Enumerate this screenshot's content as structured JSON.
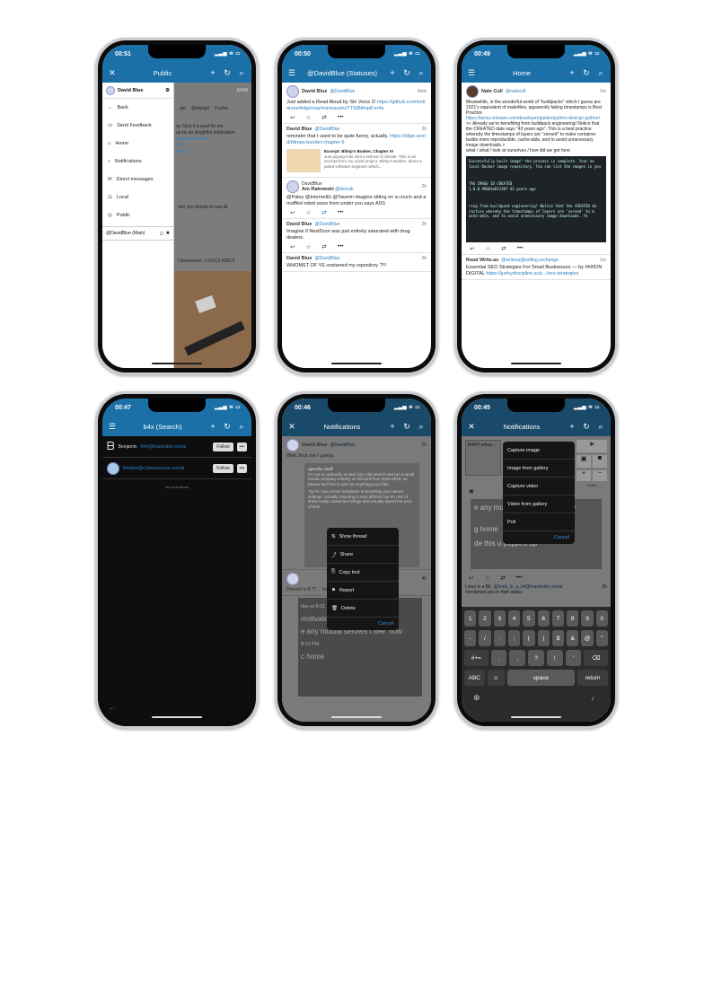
{
  "phones": [
    {
      "time": "00:51",
      "title": "Public",
      "drawer": {
        "header": "David Blue",
        "items": [
          "Back",
          "Send Feedback",
          "Home",
          "Notifications",
          "Direct messages",
          "Local",
          "Public"
        ],
        "footer": "@DavidBlue (Main)"
      },
      "background_text": [
        "NOW",
        "girl",
        "@blutrgrl",
        "Fuchia",
        "rg: Give it a read for me,",
        "up by an insightful publication",
        "storotech https://",
        "shb",
        "status",
        "hen you decide to use dit",
        "Choosevent :) #37C3 #38C3"
      ]
    },
    {
      "time": "00:50",
      "title": "@DavidBlue (Statuses)",
      "posts": [
        {
          "name": "David Blue",
          "handle": "@DavidBlue",
          "time": "Now",
          "text": "Just added a Read Aloud by Siri Voice 2! ",
          "link": "https://github.com/extratone/bilge/raw/main/audio/TTS/Blimp8.m4a"
        },
        {
          "name": "David Blue",
          "handle": "@DavidBlue",
          "time": "2h",
          "text": "reminder that I used to be quite funny, actually. ",
          "link": "https://bilge.world/blimps-bunder-chapter-6",
          "card_title": "Excerpt: Blimp's Bunker, Chapter VI",
          "card_text": "Just paying mini shot a retreat of climate. This is an excerpt from my novel project, Blimp's Bunker, about a jaded software engineer which..."
        },
        {
          "name": "Am Rakowski",
          "handle": "@decrab",
          "time": "2h",
          "boost": "DavidBlue",
          "text": "@Paley @InternetEi @Taverin imagine sitting on a couch and a muffled robot voice from under you says ASS"
        },
        {
          "name": "David Blue",
          "handle": "@DavidBlue",
          "time": "2h",
          "text": "Imagine if NextDoor was just entirely saturated with drug dealers."
        },
        {
          "name": "David Blue",
          "handle": "@DavidBlue",
          "time": "2h",
          "text": "WHOMST OF YE unstarred my repository ?!!!"
        }
      ]
    },
    {
      "time": "00:49",
      "title": "Home",
      "posts": [
        {
          "name": "Nate Cull",
          "handle": "@natecull",
          "time": "1m",
          "text": "Meanwhile, in the wonderful world of \"buildpacks\" which I guess are 2321's equivalent of makefiles, apparently faking timestamps is Best Practice",
          "link": "https://tanzu.vmware.com/developer/guides/python-kind-go-python/",
          "text2": "<< Already we're benefiting from buildpack engineering! Notice that the CREATED date says \"43 years ago\". This is a best practice whereby the timestamps of layers are \"zeroed\" to make container builds more reproducible, cache-able, and to avoid unnecessary image downloads.>",
          "text3": "what / what / look at ourselves / how did we get here",
          "image_lines": [
            "Successfully built image\" the process is complete. Your ne",
            "local Docker image repository. You can list the images in you",
            "TAG            IMAGE ID         CREATED",
            "1.0.0          998b5e81238f     43 years ago",
            "ring from buildpack engineering! Notice that the CREATED da",
            "ractice whereby the timestamps of layers are 'zeroed' to m",
            "ache-able, and to avoid unnecessary image downloads. Yo"
          ]
        },
        {
          "name": "Read Write.as",
          "handle": "@writeas@writing.exchange",
          "time": "1m",
          "text": "Essential SEO Strategies For Small Businesses — by #KRON DIGITAL",
          "link": "https://junkydiscipline.sub.../seo-strategies"
        }
      ]
    },
    {
      "time": "00:47",
      "title": "b4x (Search)",
      "results": [
        {
          "name": "Benjamin",
          "handle": "B4X@mastodon.social",
          "button": "Follow"
        },
        {
          "name": "",
          "handle": "b4xfan@cyberaccess.social",
          "button": "Follow"
        }
      ],
      "empty_text": "No more items"
    },
    {
      "time": "00:46",
      "title": "Notifications",
      "post": {
        "name": "David Blue",
        "handle": "@DavidBlue",
        "time": "1h",
        "text": "Wait, fuck me I guess.",
        "quote_title": "specific stuff",
        "quote_text": "I'm not an authority on text, but I did search and run a small media company entirely on Discord from 2016-2018, so please feel free to ask me anything you'd like.",
        "quote_text2": "Tip #1: Use server templates to bootstrap your server settings. Actually restoring is very difficult, but it's one of those really convenient things that actually saved me a lot of time."
      },
      "post2": {
        "time": "4h",
        "text": "Discord is 8:?? ... for randomly recommending"
      },
      "menu": [
        "Show thread",
        "Share",
        "Copy text",
        "Report",
        "Delete"
      ],
      "cancel": "Cancel",
      "discord_lines": [
        "day at 8:21 PM",
        "motivate myself to finally finis",
        "e any mutual servers I see. how",
        "8:22 PM",
        "c home"
      ]
    },
    {
      "time": "00:45",
      "title": "Notifications",
      "compose_text": "B4X!!! whoa...",
      "menu": [
        "Capture image",
        "Image from gallery",
        "Capture video",
        "Video from gallery",
        "Poll"
      ],
      "cancel": "Cancel",
      "visibility": "Public",
      "discord_lines": [
        "e any mutual servers I see. how",
        "g home",
        "de this u popped up"
      ],
      "notif": {
        "name": "Linux in a Bit",
        "handle": "@linux_in_a_bit@mastodon.social",
        "time": "2h",
        "text": "mentioned you in their status"
      },
      "keyboard": {
        "row1": [
          "1",
          "2",
          "3",
          "4",
          "5",
          "6",
          "7",
          "8",
          "9",
          "0"
        ],
        "row2": [
          "-",
          "/",
          ":",
          ";",
          "(",
          ")",
          "$",
          "&",
          "@",
          "\""
        ],
        "row3": [
          ".",
          ",",
          "?",
          "!",
          "'"
        ],
        "row3_left": "#+=",
        "abc": "ABC",
        "space": "space",
        "return": "return"
      }
    }
  ]
}
